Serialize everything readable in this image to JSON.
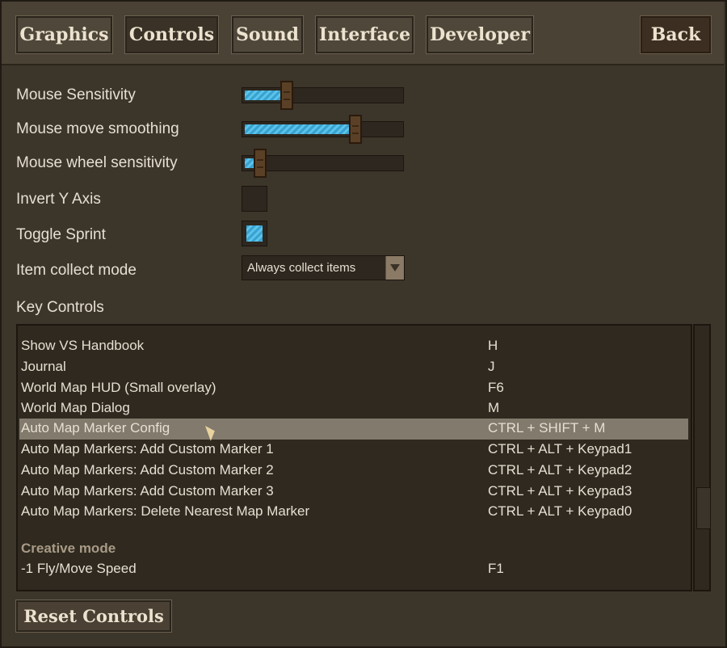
{
  "tabs": [
    {
      "label": "Graphics",
      "active": false
    },
    {
      "label": "Controls",
      "active": true
    },
    {
      "label": "Sound",
      "active": false
    },
    {
      "label": "Interface",
      "active": false
    },
    {
      "label": "Developer",
      "active": false
    }
  ],
  "back_label": "Back",
  "settings": {
    "mouse_sensitivity": {
      "label": "Mouse Sensitivity",
      "level": 0.27
    },
    "mouse_move_smoothing": {
      "label": "Mouse move smoothing",
      "level": 0.71
    },
    "mouse_wheel_sensitivity": {
      "label": "Mouse wheel sensitivity",
      "level": 0.1
    },
    "invert_y_axis": {
      "label": "Invert Y Axis",
      "checked": false
    },
    "toggle_sprint": {
      "label": "Toggle Sprint",
      "checked": true
    },
    "item_collect_mode": {
      "label": "Item collect mode",
      "value": "Always collect items"
    }
  },
  "key_controls": {
    "title": "Key Controls",
    "rows": [
      {
        "name": "Show VS Handbook",
        "keys": "H"
      },
      {
        "name": "Journal",
        "keys": "J"
      },
      {
        "name": "World Map HUD (Small overlay)",
        "keys": "F6"
      },
      {
        "name": "World Map Dialog",
        "keys": "M"
      },
      {
        "name": "Auto Map Marker Config",
        "keys": "CTRL + SHIFT + M",
        "selected": true
      },
      {
        "name": "Auto Map Markers: Add Custom Marker 1",
        "keys": "CTRL + ALT + Keypad1"
      },
      {
        "name": "Auto Map Markers: Add Custom Marker 2",
        "keys": "CTRL + ALT + Keypad2"
      },
      {
        "name": "Auto Map Markers: Add Custom Marker 3",
        "keys": "CTRL + ALT + Keypad3"
      },
      {
        "name": "Auto Map Markers: Delete Nearest Map Marker",
        "keys": "CTRL + ALT + Keypad0"
      }
    ],
    "section_creative": "Creative mode",
    "creative_rows": [
      {
        "name": "-1 Fly/Move Speed",
        "keys": "F1"
      }
    ]
  },
  "reset_label": "Reset Controls",
  "colors": {
    "slider_fill": "#3aa2d0",
    "selected_row": "#827a6c",
    "background": "#3c352a"
  }
}
